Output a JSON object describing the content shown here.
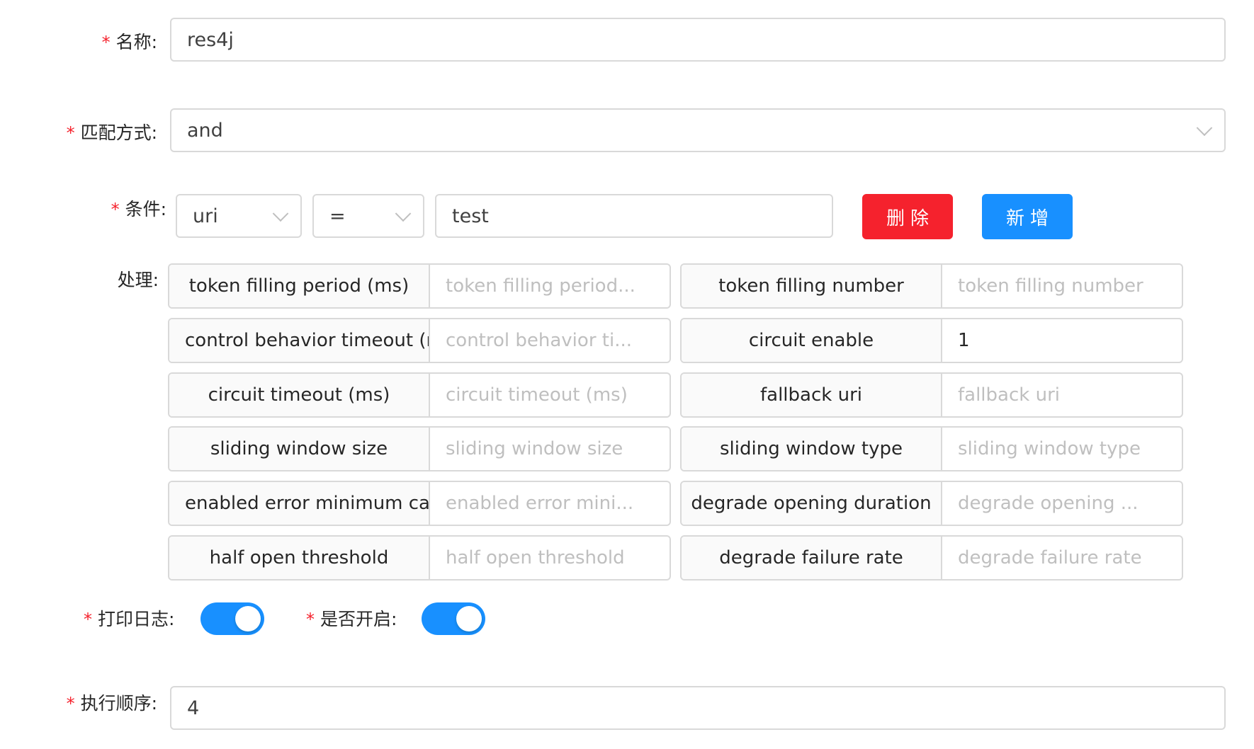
{
  "form": {
    "name": {
      "required": "*",
      "label": "名称:",
      "value": "res4j"
    },
    "match_mode": {
      "required": "*",
      "label": "匹配方式:",
      "value": "and"
    },
    "condition": {
      "required": "*",
      "label": "条件:",
      "param_type": "uri",
      "operator": "=",
      "value": "test",
      "delete_label": "删除",
      "add_label": "新增"
    },
    "handle": {
      "label": "处理:",
      "fields": [
        {
          "name": "token filling period (ms)",
          "placeholder": "token filling period...",
          "value": ""
        },
        {
          "name": "token filling number",
          "placeholder": "token filling number",
          "value": ""
        },
        {
          "name": "control behavior timeout (r",
          "placeholder": "control behavior ti...",
          "value": ""
        },
        {
          "name": "circuit enable",
          "placeholder": "",
          "value": "1"
        },
        {
          "name": "circuit timeout (ms)",
          "placeholder": "circuit timeout (ms)",
          "value": ""
        },
        {
          "name": "fallback uri",
          "placeholder": "fallback uri",
          "value": ""
        },
        {
          "name": "sliding window size",
          "placeholder": "sliding window size",
          "value": ""
        },
        {
          "name": "sliding window type",
          "placeholder": "sliding window type",
          "value": ""
        },
        {
          "name": "enabled error minimum cal",
          "placeholder": "enabled error mini...",
          "value": ""
        },
        {
          "name": "degrade opening duration",
          "placeholder": "degrade opening ...",
          "value": ""
        },
        {
          "name": "half open threshold",
          "placeholder": "half open threshold",
          "value": ""
        },
        {
          "name": "degrade failure rate",
          "placeholder": "degrade failure rate",
          "value": ""
        }
      ]
    },
    "logged": {
      "required": "*",
      "label": "打印日志:",
      "on": true
    },
    "enabled": {
      "required": "*",
      "label": "是否开启:",
      "on": true
    },
    "sort": {
      "required": "*",
      "label": "执行顺序:",
      "value": "4"
    }
  },
  "colors": {
    "primary": "#1890ff",
    "danger": "#f5222d",
    "border": "#d9d9d9",
    "placeholder": "#bfbfbf"
  }
}
